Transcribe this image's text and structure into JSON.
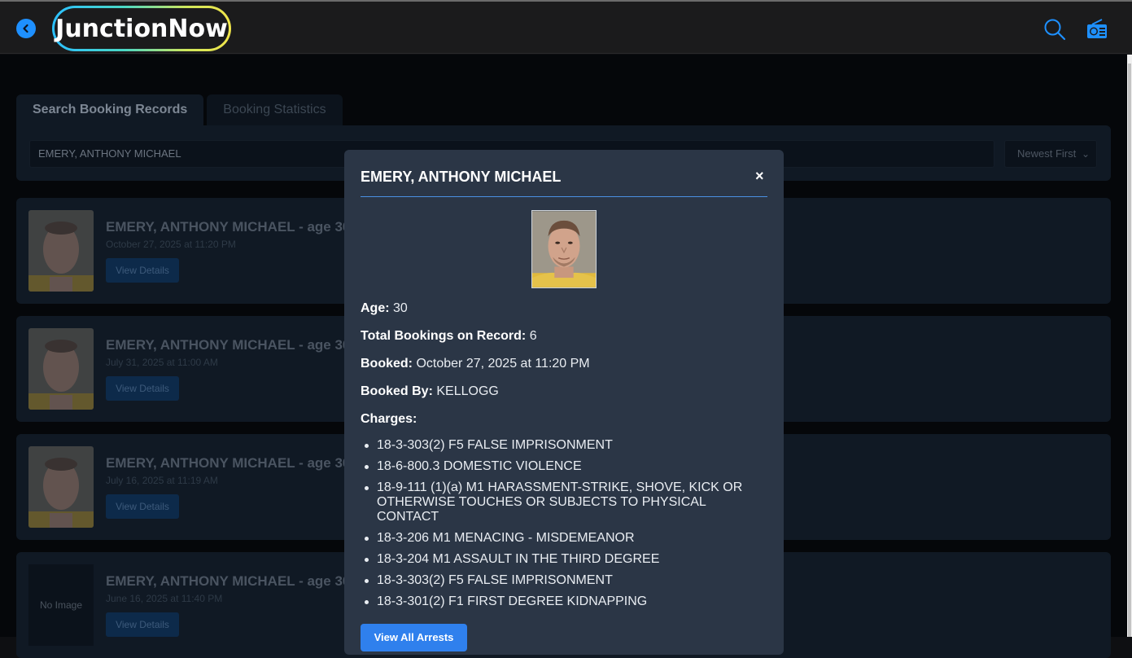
{
  "header": {
    "logo_text": "JunctionNow",
    "back_icon": "chevron-left-icon",
    "search_icon": "search-icon",
    "radio_icon": "radio-icon",
    "accent": "#1e90ff"
  },
  "tabs": [
    {
      "label": "Search Booking Records",
      "active": true
    },
    {
      "label": "Booking Statistics",
      "active": false
    }
  ],
  "search": {
    "value": "EMERY, ANTHONY MICHAEL",
    "sort_selected": "Newest First"
  },
  "results": [
    {
      "name": "EMERY, ANTHONY MICHAEL - age 30",
      "date": "October 27, 2025 at 11:20 PM",
      "button": "View Details",
      "has_image": true
    },
    {
      "name": "EMERY, ANTHONY MICHAEL - age 30",
      "date": "July 31, 2025 at 11:00 AM",
      "button": "View Details",
      "has_image": true
    },
    {
      "name": "EMERY, ANTHONY MICHAEL - age 30",
      "date": "July 16, 2025 at 11:19 AM",
      "button": "View Details",
      "has_image": true
    },
    {
      "name": "EMERY, ANTHONY MICHAEL - age 30",
      "date": "June 16, 2025 at 11:40 PM",
      "button": "View Details",
      "has_image": false,
      "no_image_text": "No Image"
    }
  ],
  "modal": {
    "title": "EMERY, ANTHONY MICHAEL",
    "close": "×",
    "age_label": "Age:",
    "age_value": "30",
    "total_label": "Total Bookings on Record:",
    "total_value": "6",
    "booked_label": "Booked:",
    "booked_value": "October 27, 2025 at 11:20 PM",
    "booked_by_label": "Booked By:",
    "booked_by_value": "KELLOGG",
    "charges_label": "Charges:",
    "charges": [
      "18-3-303(2) F5 FALSE IMPRISONMENT",
      "18-6-800.3 DOMESTIC VIOLENCE",
      "18-9-111 (1)(a) M1 HARASSMENT-STRIKE, SHOVE, KICK OR OTHERWISE TOUCHES OR SUBJECTS TO PHYSICAL CONTACT",
      "18-3-206 M1 MENACING - MISDEMEANOR",
      "18-3-204 M1 ASSAULT IN THE THIRD DEGREE",
      "18-3-303(2) F5 FALSE IMPRISONMENT",
      "18-3-301(2) F1 FIRST DEGREE KIDNAPPING"
    ],
    "button": "View All Arrests"
  }
}
